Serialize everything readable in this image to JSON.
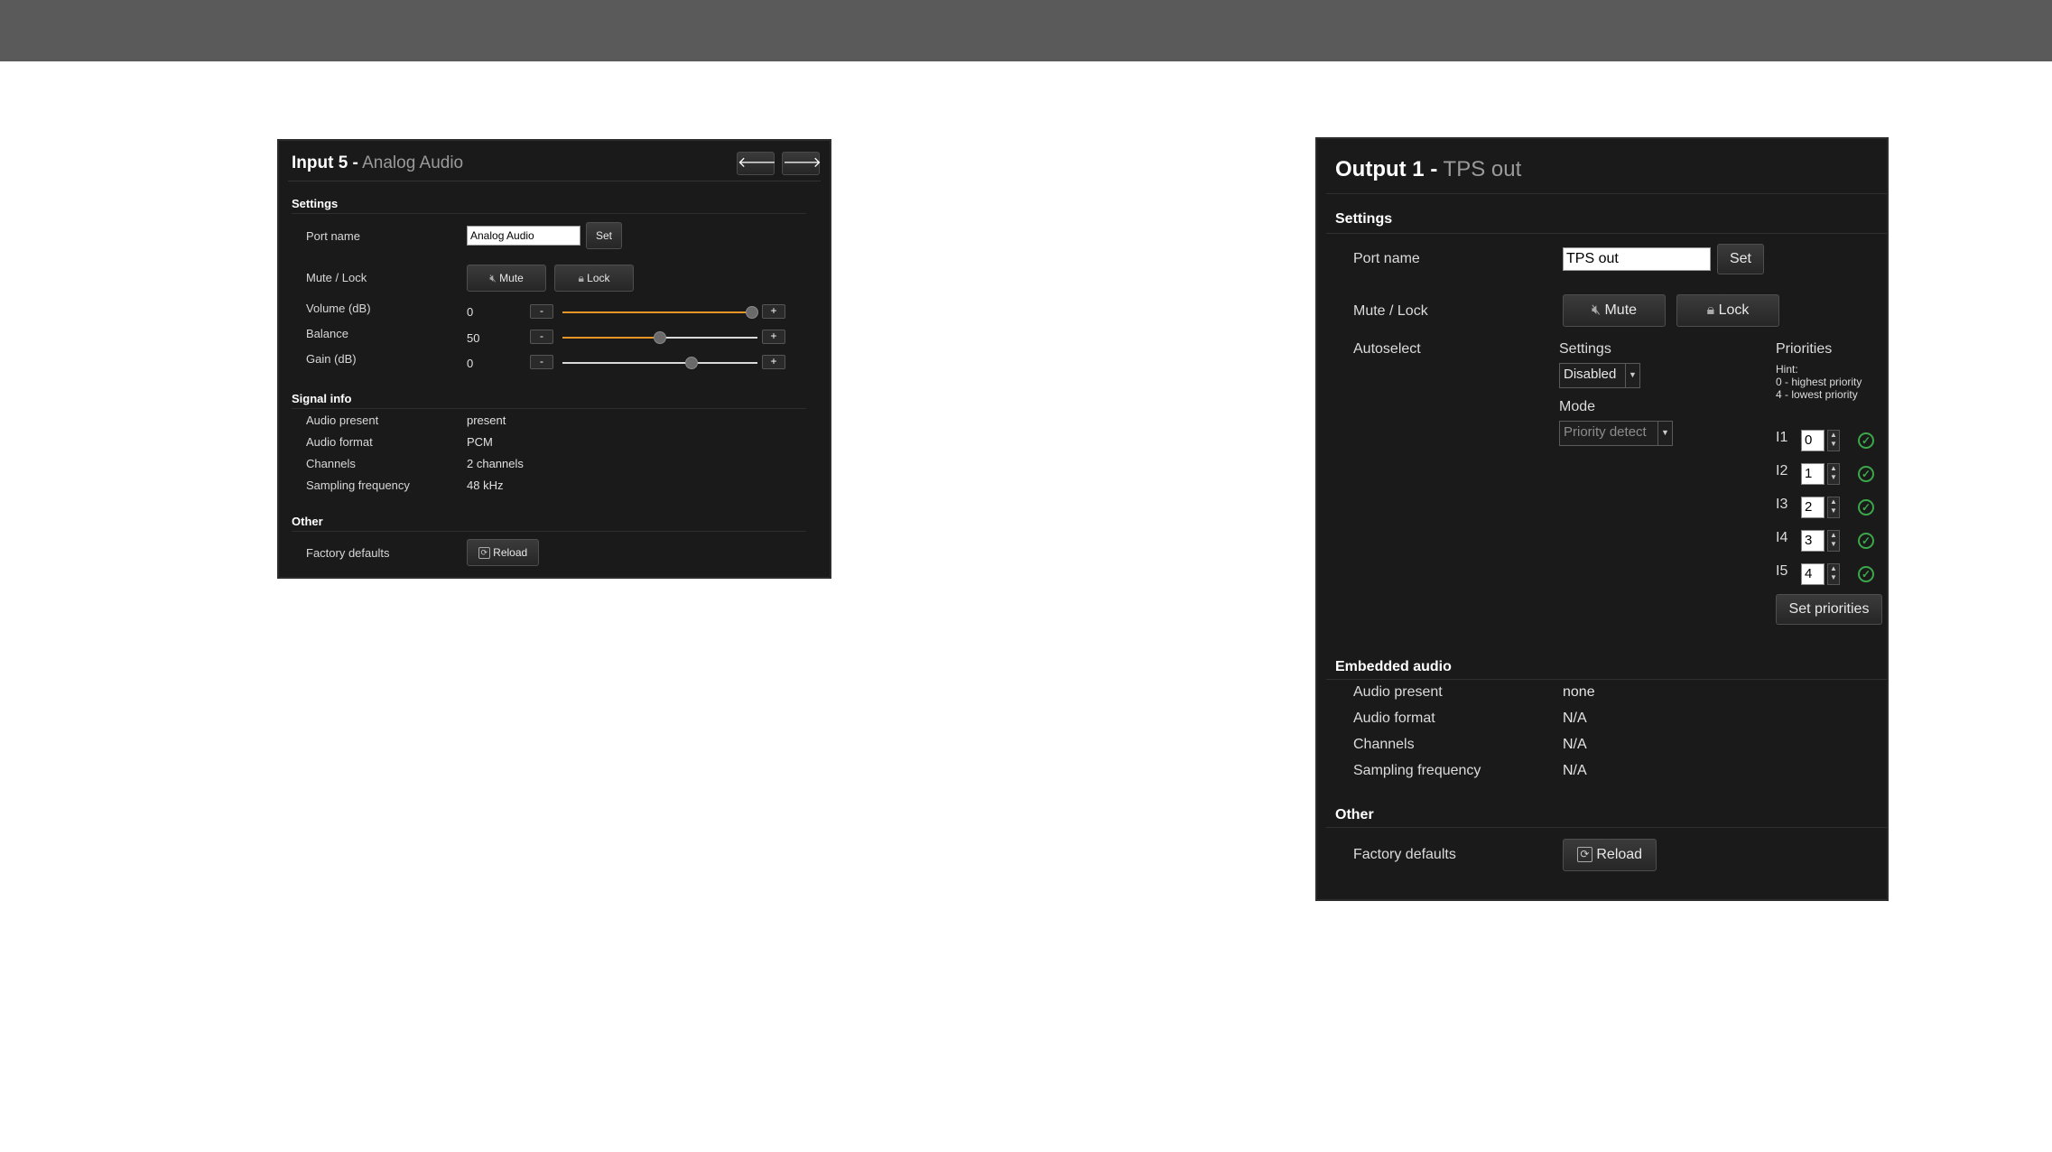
{
  "input_panel": {
    "title_main": "Input 5 -",
    "title_sub": "Analog Audio",
    "nav_prev": "🡐",
    "nav_next": "🡒",
    "settings_heading": "Settings",
    "port_name_label": "Port name",
    "port_name_value": "Analog Audio",
    "set_label": "Set",
    "mute_lock_label": "Mute / Lock",
    "mute_label": "Mute",
    "lock_label": "Lock",
    "volume_label": "Volume (dB)",
    "volume_value": "0",
    "volume_level": 0.97,
    "balance_label": "Balance",
    "balance_value": "50",
    "balance_level": 0.5,
    "gain_label": "Gain (dB)",
    "gain_value": "0",
    "gain_level": 0.66,
    "minus": "-",
    "plus": "+",
    "signal_heading": "Signal info",
    "signal_rows": [
      {
        "label": "Audio present",
        "value": "present"
      },
      {
        "label": "Audio format",
        "value": "PCM"
      },
      {
        "label": "Channels",
        "value": "2 channels"
      },
      {
        "label": "Sampling frequency",
        "value": "48 kHz"
      }
    ],
    "other_heading": "Other",
    "factory_label": "Factory defaults",
    "reload_label": "Reload",
    "accent_color": "#e69526"
  },
  "output_panel": {
    "title_main": "Output 1 -",
    "title_sub": "TPS out",
    "settings_heading": "Settings",
    "port_name_label": "Port name",
    "port_name_value": "TPS out",
    "set_label": "Set",
    "mute_lock_label": "Mute / Lock",
    "mute_label": "Mute",
    "lock_label": "Lock",
    "autoselect_label": "Autoselect",
    "autoselect_settings_label": "Settings",
    "autoselect_settings_value": "Disabled",
    "mode_label": "Mode",
    "mode_value": "Priority detect",
    "priorities_label": "Priorities",
    "hint_line1": "Hint:",
    "hint_line2": "0 - highest priority",
    "hint_line3": "4 - lowest priority",
    "priorities": [
      {
        "input": "I1",
        "value": "0"
      },
      {
        "input": "I2",
        "value": "1"
      },
      {
        "input": "I3",
        "value": "2"
      },
      {
        "input": "I4",
        "value": "3"
      },
      {
        "input": "I5",
        "value": "4"
      }
    ],
    "set_priorities_label": "Set priorities",
    "embedded_heading": "Embedded audio",
    "embedded_rows": [
      {
        "label": "Audio present",
        "value": "none"
      },
      {
        "label": "Audio format",
        "value": "N/A"
      },
      {
        "label": "Channels",
        "value": "N/A"
      },
      {
        "label": "Sampling frequency",
        "value": "N/A"
      }
    ],
    "other_heading": "Other",
    "factory_label": "Factory defaults",
    "reload_label": "Reload",
    "status_color": "#3ba84a"
  }
}
